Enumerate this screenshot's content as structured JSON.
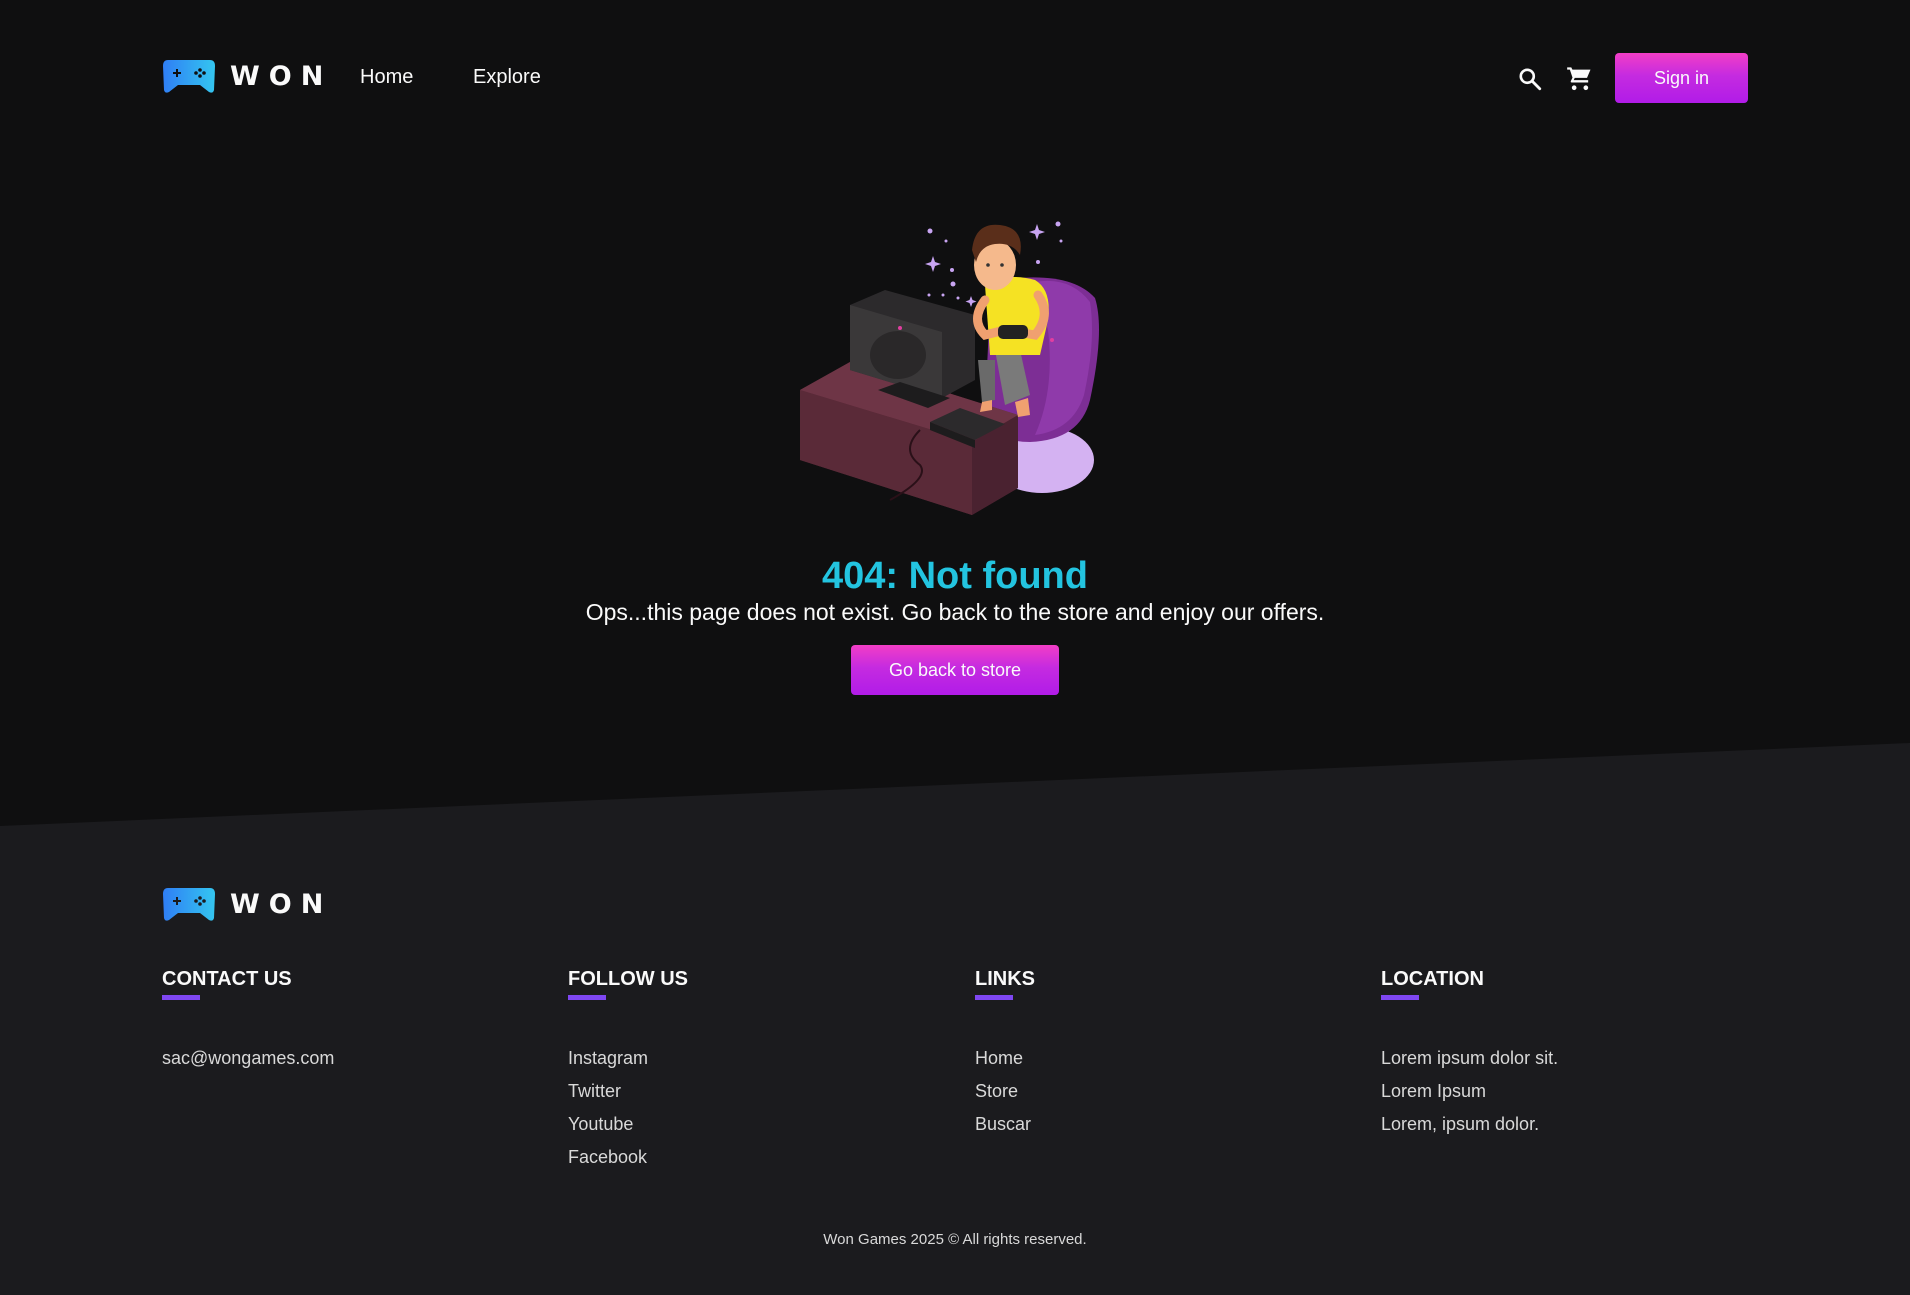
{
  "brand": {
    "name": "WON",
    "icon": "gamepad-icon"
  },
  "header": {
    "nav": [
      "Home",
      "Explore"
    ],
    "search_icon": "search-icon",
    "cart_icon": "cart-icon",
    "signin_label": "Sign in"
  },
  "main": {
    "illustration": "gamer-illustration",
    "title": "404: Not found",
    "message": "Ops...this page does not exist. Go back to the store and enjoy our offers.",
    "button_label": "Go back to store"
  },
  "footer": {
    "contact": {
      "heading": "CONTACT US",
      "items": [
        "sac@wongames.com"
      ]
    },
    "follow": {
      "heading": "FOLLOW US",
      "items": [
        "Instagram",
        "Twitter",
        "Youtube",
        "Facebook"
      ]
    },
    "links": {
      "heading": "LINKS",
      "items": [
        "Home",
        "Store",
        "Buscar"
      ]
    },
    "location": {
      "heading": "LOCATION",
      "items": [
        "Lorem ipsum dolor sit.",
        "Lorem Ipsum",
        "Lorem, ipsum dolor."
      ]
    },
    "copyright": "Won Games 2025 © All rights reserved."
  },
  "colors": {
    "background": "#0f0f10",
    "footer_background": "#1b1b1e",
    "accent_magenta": "#c52be0",
    "title_cyan": "#23c4e0",
    "underline_purple": "#7f47f2"
  }
}
